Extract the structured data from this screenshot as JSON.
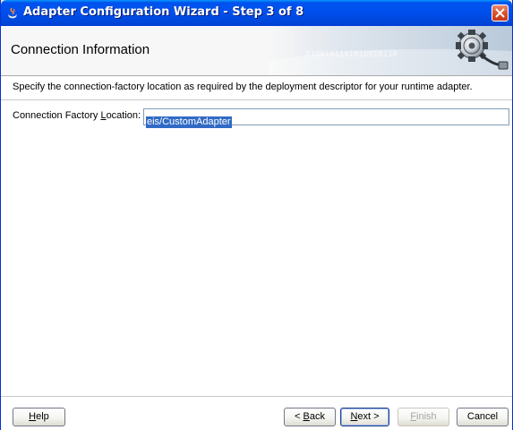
{
  "window": {
    "title": "Adapter Configuration Wizard - Step 3 of 8"
  },
  "header": {
    "title": "Connection Information",
    "art_text": "0100101101010010110"
  },
  "main": {
    "instructions": "Specify the connection-factory location as required by the deployment descriptor for your runtime adapter.",
    "field": {
      "label_before": "Connection Factory ",
      "label_mnemonic": "L",
      "label_after": "ocation:",
      "value": "eis/CustomAdapter"
    }
  },
  "footer": {
    "help": {
      "mnemonic": "H",
      "rest": "elp"
    },
    "back": {
      "prefix": "< ",
      "mnemonic": "B",
      "rest": "ack"
    },
    "next": {
      "mnemonic": "N",
      "rest": "ext >"
    },
    "finish": {
      "mnemonic": "F",
      "rest": "inish"
    },
    "cancel": "Cancel"
  },
  "icons": {
    "app": "java-cup-icon",
    "close": "close-icon",
    "wizard": "gear-plug-icon"
  },
  "colors": {
    "titlebar": "#0053ee",
    "close_button": "#d8532f",
    "selection": "#316ac5"
  }
}
